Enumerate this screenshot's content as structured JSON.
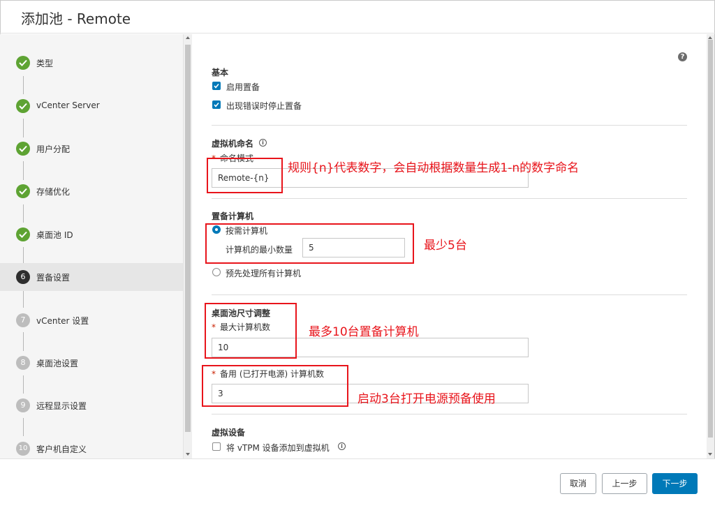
{
  "dialog": {
    "title": "添加池 - Remote"
  },
  "sidebar": {
    "steps": [
      {
        "label": "类型",
        "status": "done"
      },
      {
        "label": "vCenter Server",
        "status": "done"
      },
      {
        "label": "用户分配",
        "status": "done"
      },
      {
        "label": "存储优化",
        "status": "done"
      },
      {
        "label": "桌面池 ID",
        "status": "done"
      },
      {
        "num": "6",
        "label": "置备设置",
        "status": "current"
      },
      {
        "num": "7",
        "label": "vCenter 设置",
        "status": "todo"
      },
      {
        "num": "8",
        "label": "桌面池设置",
        "status": "todo"
      },
      {
        "num": "9",
        "label": "远程显示设置",
        "status": "todo"
      },
      {
        "num": "10",
        "label": "客户机自定义",
        "status": "todo"
      }
    ]
  },
  "main": {
    "help": "?",
    "basic": {
      "title": "基本",
      "enable_provisioning": "启用置备",
      "stop_on_error": "出现错误时停止置备"
    },
    "vm_naming": {
      "title": "虚拟机命名",
      "pattern_label": "命名模式",
      "pattern_value": "Remote-{n}"
    },
    "provision_machines": {
      "title": "置备计算机",
      "on_demand": "按需计算机",
      "min_label": "计算机的最小数量",
      "min_value": "5",
      "all_upfront": "预先处理所有计算机"
    },
    "pool_sizing": {
      "title": "桌面池尺寸调整",
      "max_label": "最大计算机数",
      "max_value": "10",
      "spare_label": "备用 (已打开电源) 计算机数",
      "spare_value": "3"
    },
    "virtual_device": {
      "title": "虚拟设备",
      "vtpm_label": "将 vTPM 设备添加到虚拟机"
    }
  },
  "annotations": {
    "naming": "规则{n}代表数字，会自动根据数量生成1-n的数字命名",
    "min": "最少5台",
    "max": "最多10台置备计算机",
    "spare": "启动3台打开电源预备使用"
  },
  "footer": {
    "cancel": "取消",
    "back": "上一步",
    "next": "下一步"
  },
  "colors": {
    "accent": "#0079b8",
    "done": "#5ea333",
    "annotation": "#e8141b"
  }
}
